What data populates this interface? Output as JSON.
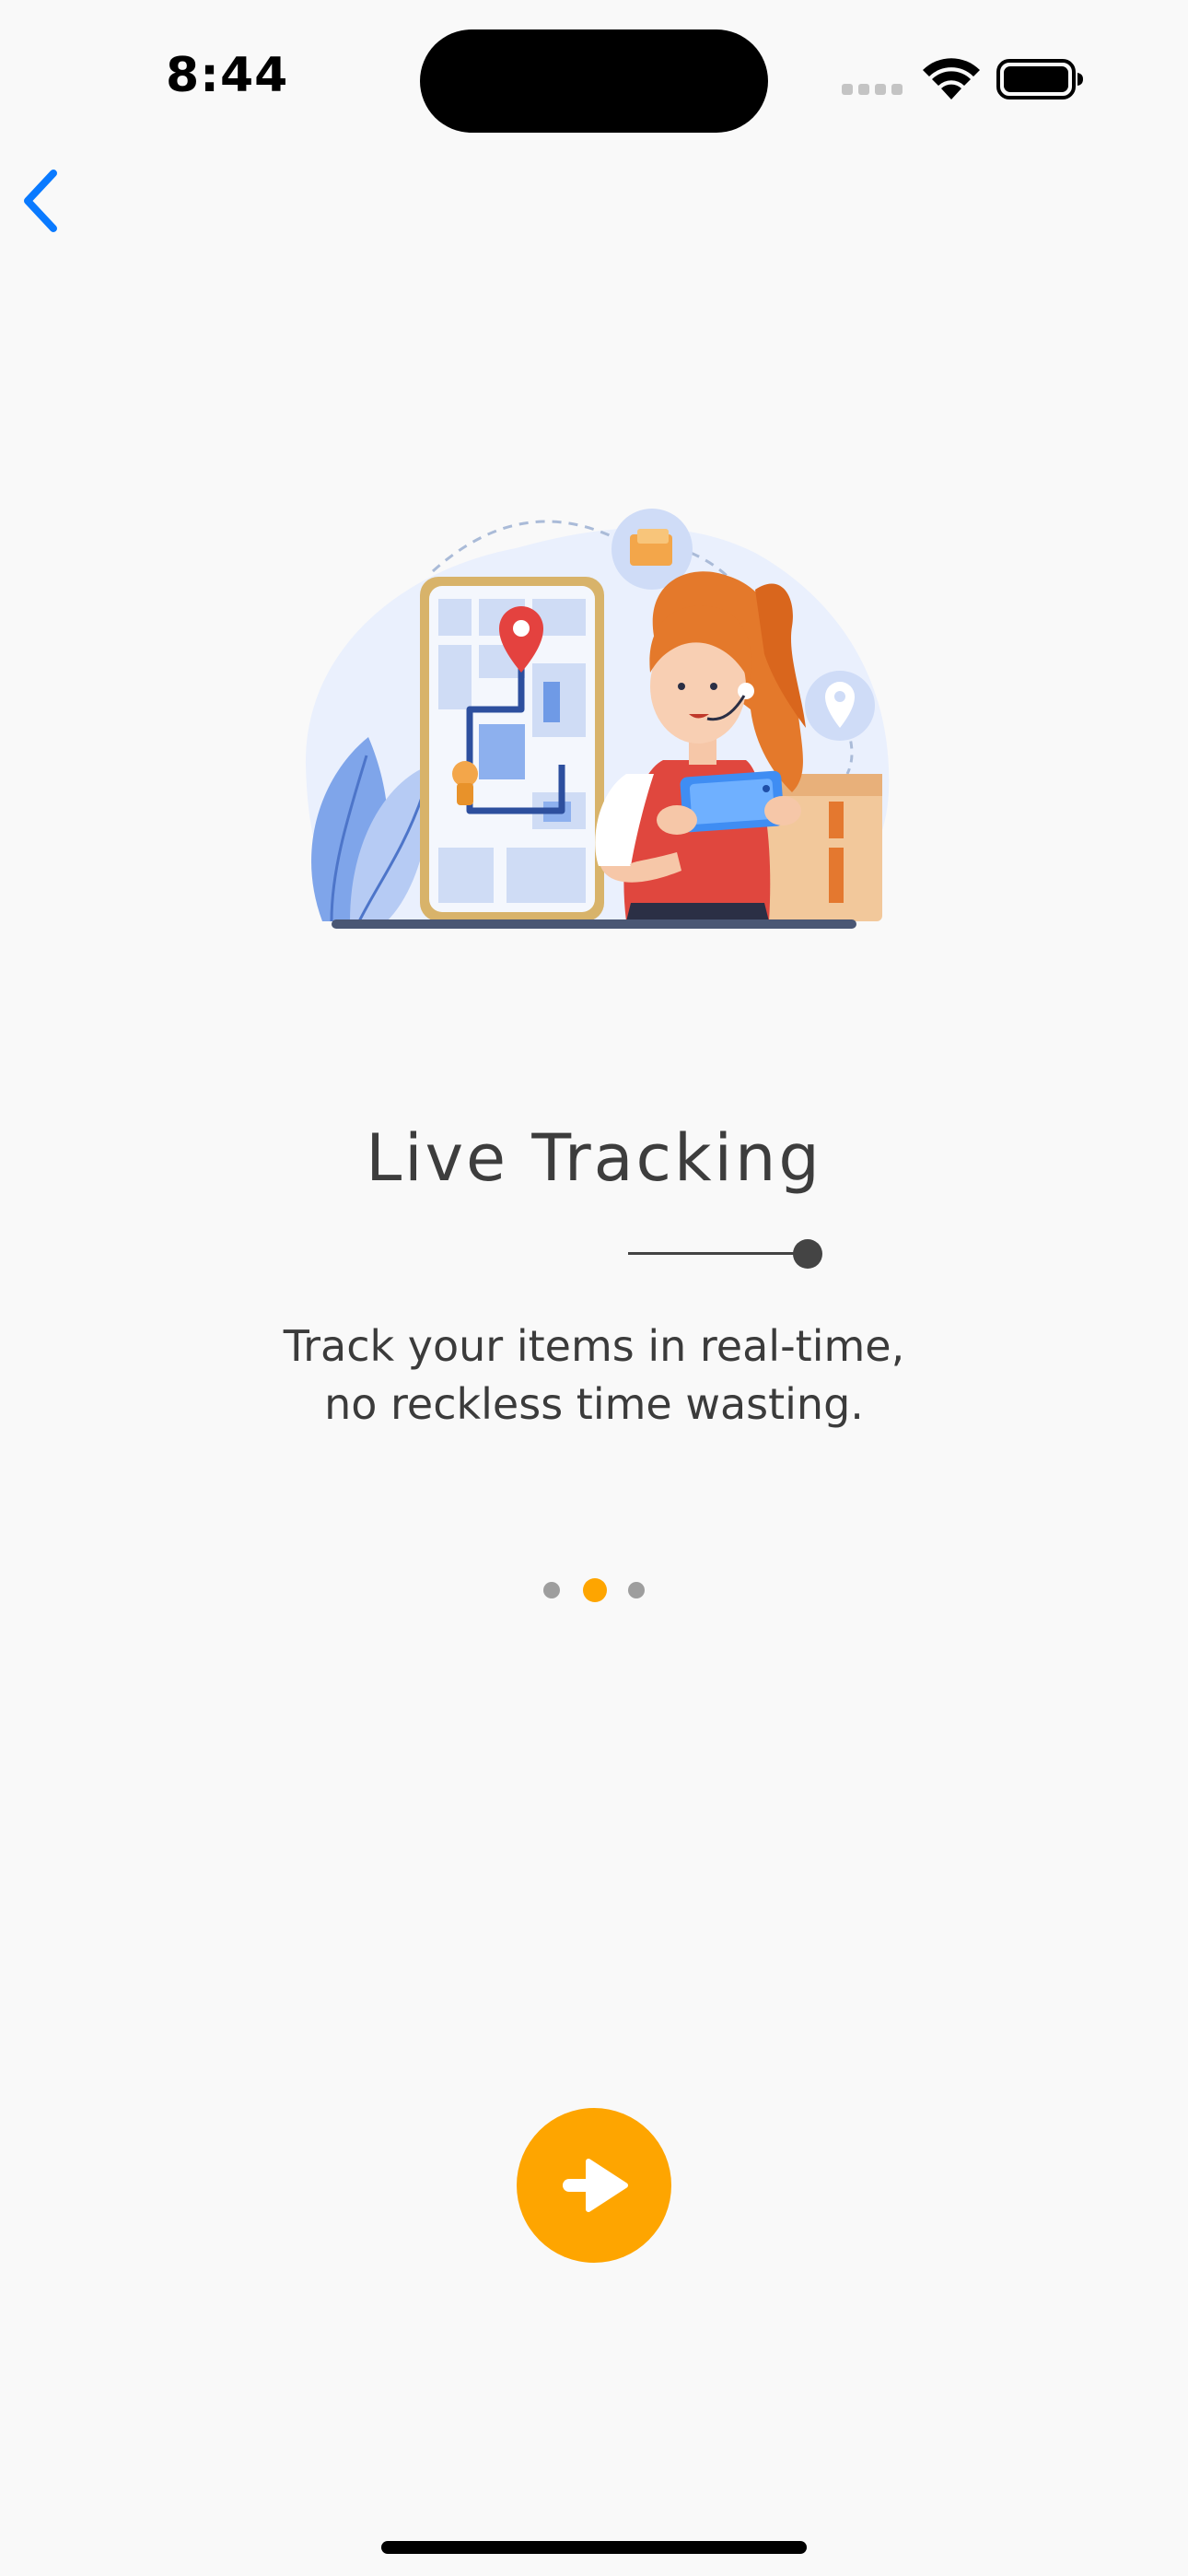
{
  "status_bar": {
    "time": "8:44",
    "icons": [
      "cellular-signal-icon",
      "wifi-icon",
      "battery-icon"
    ]
  },
  "navigation": {
    "back_icon": "chevron-left-icon"
  },
  "onboarding": {
    "illustration": "delivery-tracking-illustration",
    "title": "Live Tracking",
    "description": "Track your items in real-time, no reckless time wasting.",
    "page_indicator": {
      "total_pages": 3,
      "current_page": 2
    },
    "next_button_icon": "arrow-right-icon"
  },
  "colors": {
    "accent": "#FEA500",
    "background": "#F9F9F9",
    "text_primary": "#3D3D3D",
    "link_blue": "#0A7AFF",
    "inactive_dot": "#9E9E9E"
  }
}
